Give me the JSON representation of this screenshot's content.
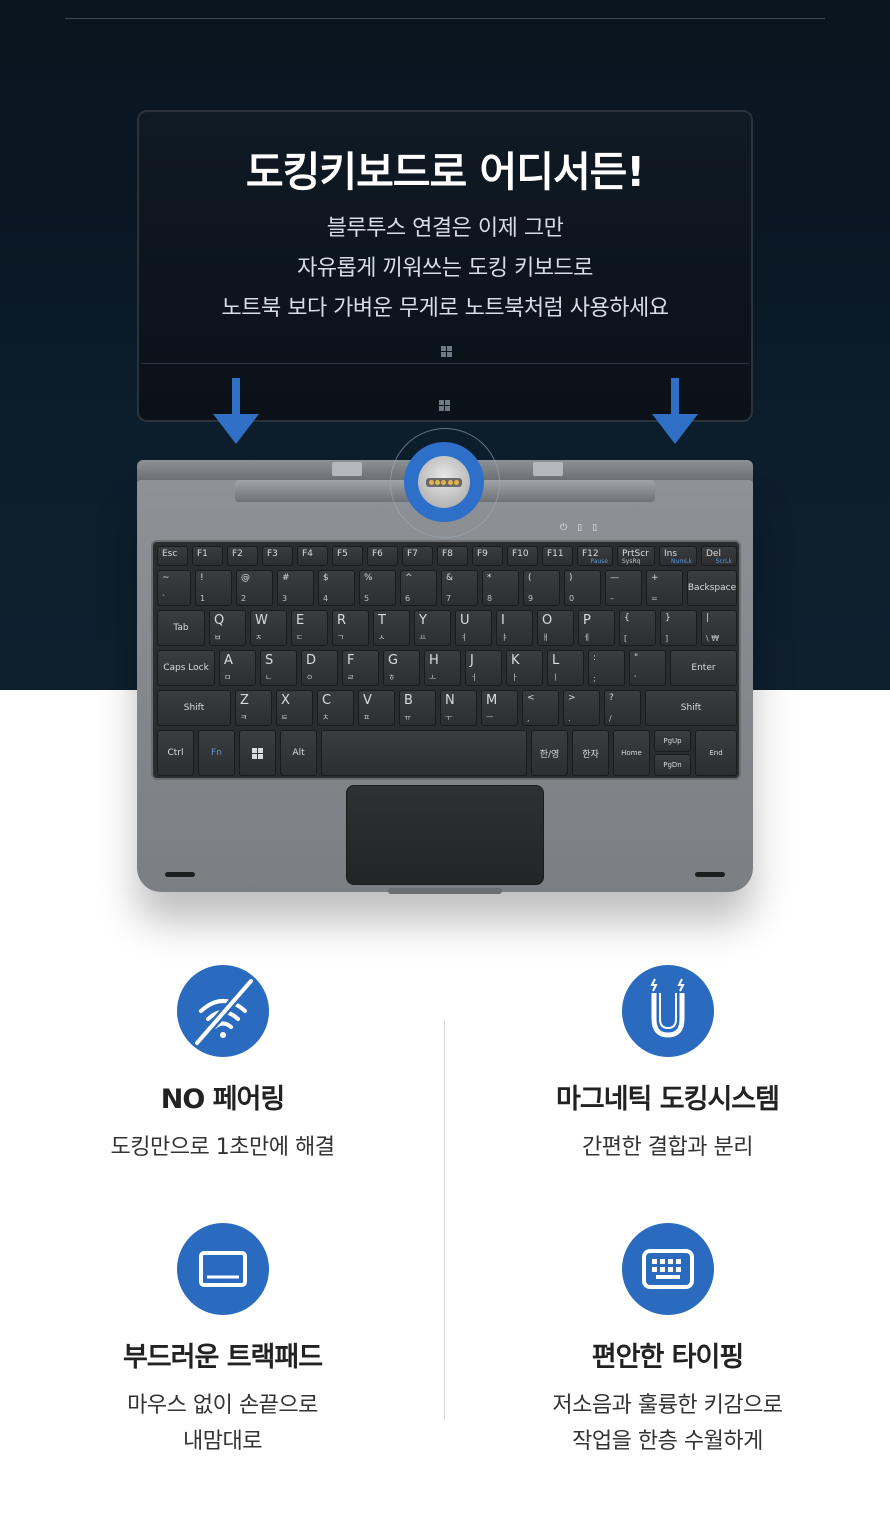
{
  "hero": {
    "title": "도킹키보드로 어디서든!",
    "lines": [
      "블루투스 연결은 이제 그만",
      "자유롭게 끼워쓰는 도킹 키보드로",
      "노트북 보다 가벼운 무게로 노트북처럼 사용하세요"
    ]
  },
  "keyboard": {
    "row0": [
      "Esc",
      "F1",
      "F2",
      "F3",
      "F4",
      "F5",
      "F6",
      "F7",
      "F8",
      "F9",
      "F10",
      "F11",
      "F12",
      "PrtScr",
      "Ins",
      "Del"
    ],
    "row0_sub": [
      "",
      "",
      "",
      "",
      "",
      "",
      "",
      "",
      "",
      "",
      "",
      "",
      "Pause",
      "SysRq",
      "NumLk",
      "ScrLk"
    ],
    "row1": [
      "~",
      "!",
      "@",
      "#",
      "$",
      "%",
      "^",
      "&",
      "*",
      "(",
      ")",
      "—",
      "+",
      "Backspace"
    ],
    "row1_sub": [
      "`",
      "1",
      "2",
      "3",
      "4",
      "5",
      "6",
      "7",
      "8",
      "9",
      "0",
      "–",
      "="
    ],
    "row2": [
      "Tab",
      "Q",
      "W",
      "E",
      "R",
      "T",
      "Y",
      "U",
      "I",
      "O",
      "P",
      "{",
      "}",
      "|"
    ],
    "row2_sub": [
      "",
      "ㅂ",
      "ㅈ",
      "ㄷ",
      "ㄱ",
      "ㅅ",
      "ㅛ",
      "ㅕ",
      "ㅑ",
      "ㅐ",
      "ㅔ",
      "[",
      "]",
      "\\ ₩"
    ],
    "row3": [
      "Caps Lock",
      "A",
      "S",
      "D",
      "F",
      "G",
      "H",
      "J",
      "K",
      "L",
      ":",
      "\"",
      "Enter"
    ],
    "row3_sub": [
      "",
      "ㅁ",
      "ㄴ",
      "ㅇ",
      "ㄹ",
      "ㅎ",
      "ㅗ",
      "ㅓ",
      "ㅏ",
      "ㅣ",
      ";",
      "'"
    ],
    "row4": [
      "Shift",
      "Z",
      "X",
      "C",
      "V",
      "B",
      "N",
      "M",
      "<",
      ">",
      "?",
      "Shift"
    ],
    "row4_sub": [
      "",
      "ㅋ",
      "ㅌ",
      "ㅊ",
      "ㅍ",
      "ㅠ",
      "ㅜ",
      "ㅡ",
      ",",
      ".",
      "/"
    ],
    "row5": [
      "Ctrl",
      "Fn",
      "",
      "Alt",
      "",
      "한/영",
      "한자",
      "Home",
      "PgUp",
      "PgDn",
      "End"
    ],
    "led_icons": [
      "⏻",
      "▯",
      "▯"
    ]
  },
  "features": [
    {
      "icon": "no-wifi-icon",
      "title": "NO 페어링",
      "desc": [
        "도킹만으로 1초만에 해결"
      ]
    },
    {
      "icon": "magnet-icon",
      "title": "마그네틱 도킹시스템",
      "desc": [
        "간편한 결합과 분리"
      ]
    },
    {
      "icon": "trackpad-icon",
      "title": "부드러운 트랙패드",
      "desc": [
        "마우스 없이 손끝으로",
        "내맘대로"
      ]
    },
    {
      "icon": "keyboard-icon",
      "title": "편안한 타이핑",
      "desc": [
        "저소음과 훌륭한 키감으로",
        "작업을 한층 수월하게"
      ]
    }
  ],
  "colors": {
    "accent": "#2a6bbf",
    "hero_bg": "#0b1520"
  }
}
